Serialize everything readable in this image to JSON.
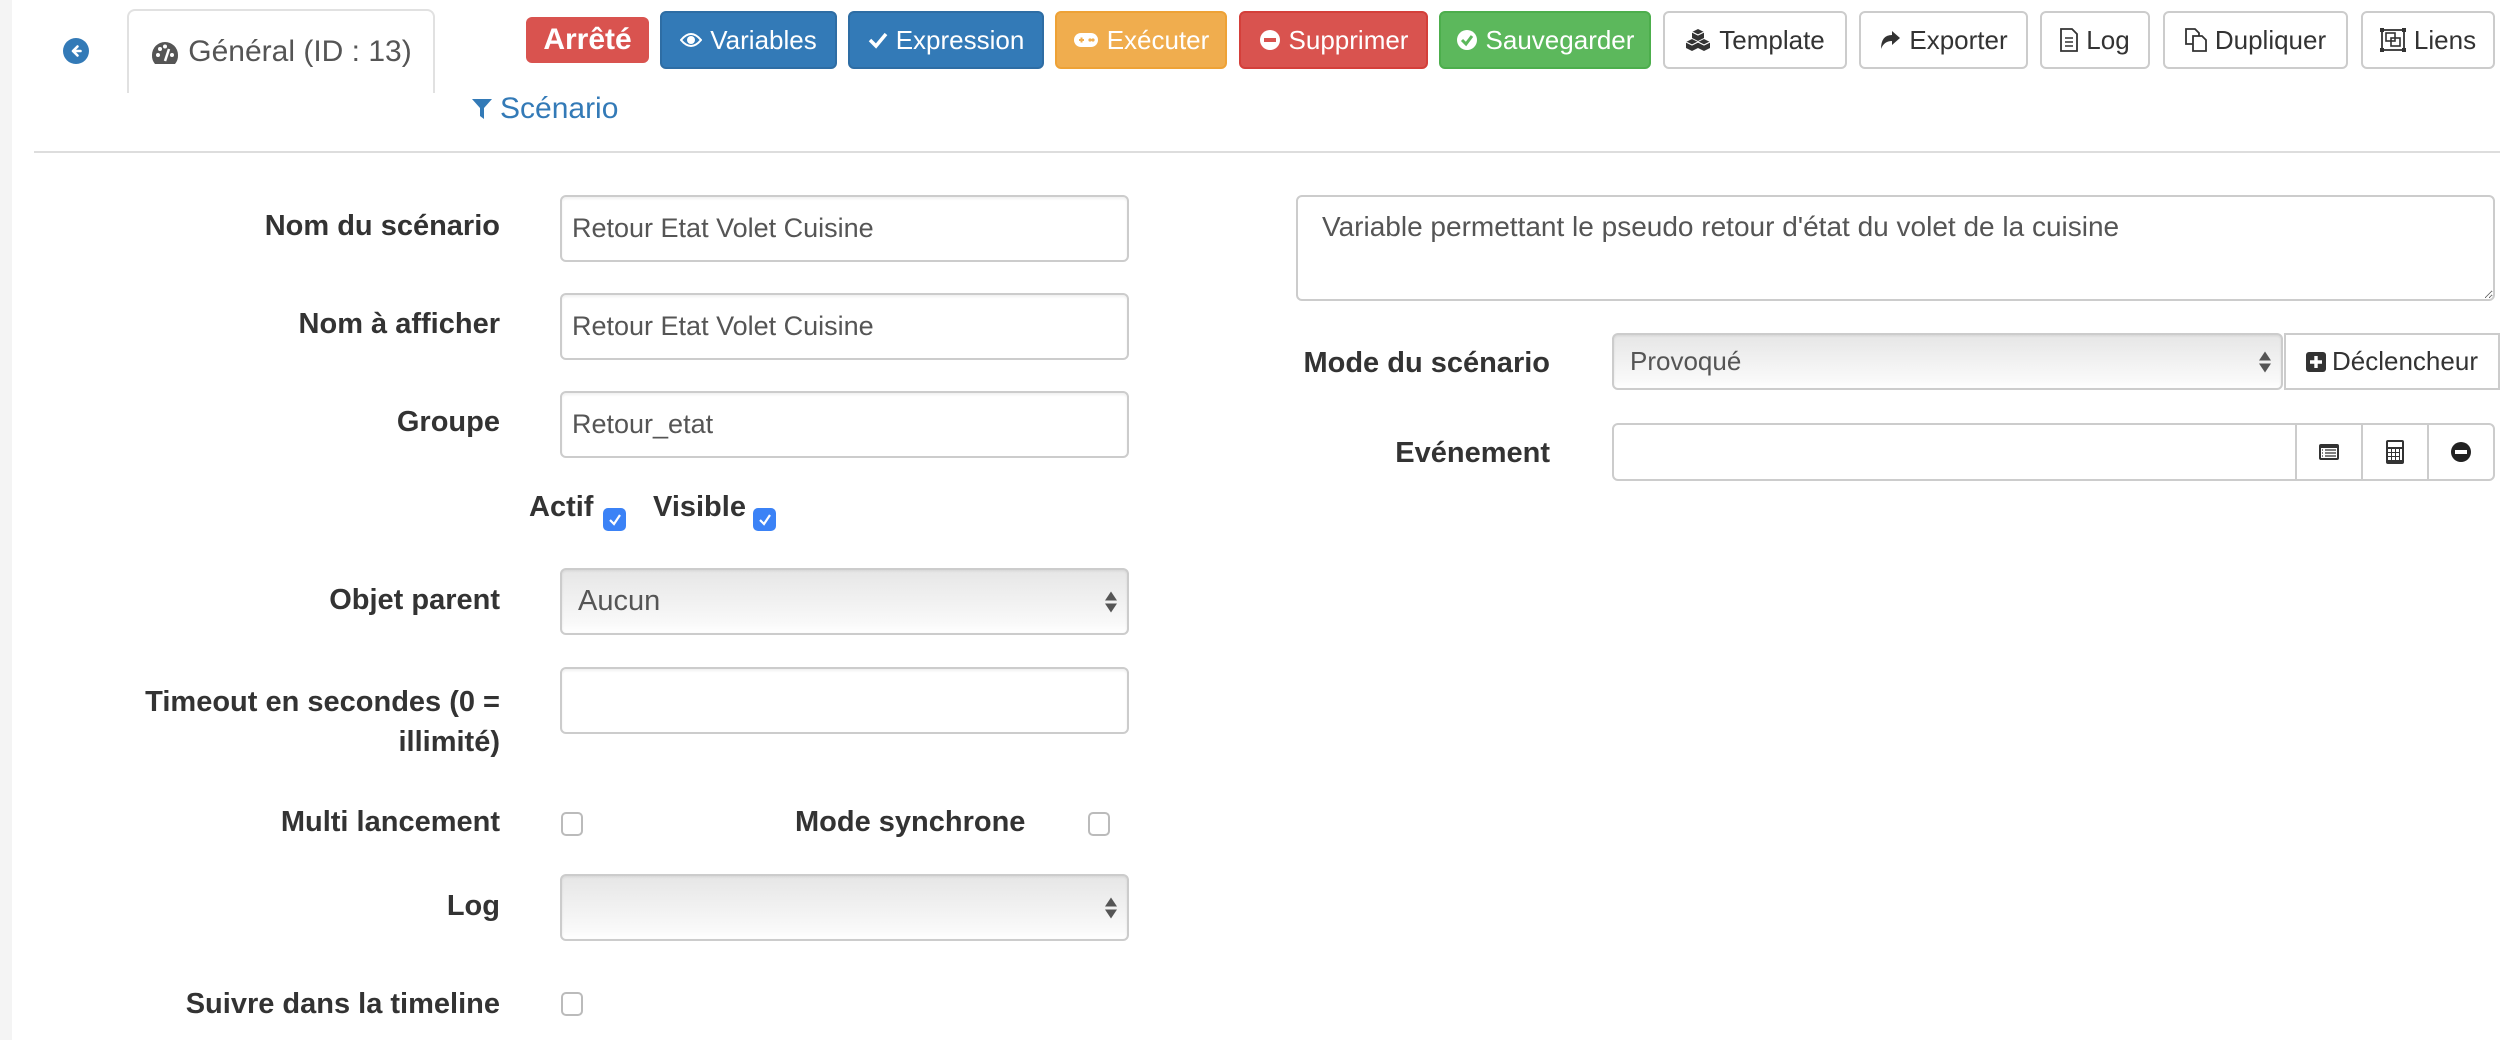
{
  "nav": {
    "back_icon": "circle-arrow-left-icon",
    "tabs": [
      {
        "label": "Général (ID : 13)",
        "icon": "tachometer-icon",
        "active": true
      },
      {
        "label": "Scénario",
        "icon": "filter-icon",
        "active": false
      }
    ]
  },
  "toolbar": {
    "state_badge": "Arrêté",
    "buttons": [
      {
        "label": "Variables",
        "icon": "eye-icon",
        "style": "primary"
      },
      {
        "label": "Expression",
        "icon": "check-icon",
        "style": "primary"
      },
      {
        "label": "Exécuter",
        "icon": "gamepad-icon",
        "style": "warning"
      },
      {
        "label": "Supprimer",
        "icon": "minus-circle-icon",
        "style": "danger"
      },
      {
        "label": "Sauvegarder",
        "icon": "check-circle-icon",
        "style": "success"
      },
      {
        "label": "Template",
        "icon": "cubes-icon",
        "style": "default"
      },
      {
        "label": "Exporter",
        "icon": "share-icon",
        "style": "default"
      },
      {
        "label": "Log",
        "icon": "file-text-icon",
        "style": "default"
      },
      {
        "label": "Dupliquer",
        "icon": "files-icon",
        "style": "default"
      },
      {
        "label": "Liens",
        "icon": "object-group-icon",
        "style": "default"
      }
    ]
  },
  "form": {
    "name": {
      "label": "Nom du scénario",
      "value": "Retour Etat Volet Cuisine"
    },
    "display_name": {
      "label": "Nom à afficher",
      "value": "Retour Etat Volet Cuisine"
    },
    "group": {
      "label": "Groupe",
      "value": "Retour_etat"
    },
    "active": {
      "label": "Actif",
      "checked": true
    },
    "visible": {
      "label": "Visible",
      "checked": true
    },
    "parent": {
      "label": "Objet parent",
      "selected": "Aucun"
    },
    "timeout": {
      "label_line1": "Timeout en secondes (0 =",
      "label_line2": "illimité)",
      "value": ""
    },
    "multi_launch": {
      "label": "Multi lancement",
      "checked": false
    },
    "sync_mode": {
      "label": "Mode synchrone",
      "checked": false
    },
    "log": {
      "label": "Log",
      "selected": ""
    },
    "timeline": {
      "label": "Suivre dans la timeline",
      "checked": false
    },
    "description": {
      "value": "Variable permettant le pseudo retour d'état du volet de la cuisine"
    },
    "mode": {
      "label": "Mode du scénario",
      "selected": "Provoqué"
    },
    "trigger_button": {
      "label": "Déclencheur",
      "icon": "plus-square-icon"
    },
    "event": {
      "label": "Evénement",
      "value": "",
      "addons": [
        "list-alt-icon",
        "calculator-icon",
        "minus-circle-icon"
      ]
    }
  },
  "colors": {
    "primary": "#337ab7",
    "warning": "#f0ad4e",
    "danger": "#d9534f",
    "success": "#5cb85c",
    "checkbox": "#3b82f6"
  }
}
